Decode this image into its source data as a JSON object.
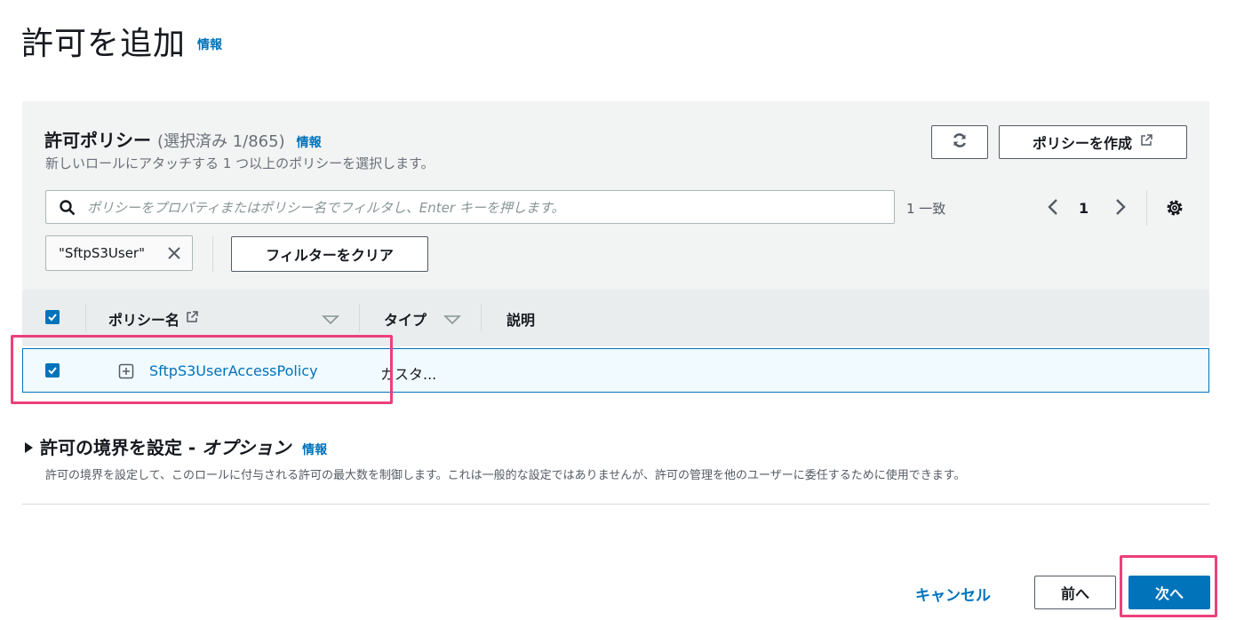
{
  "page": {
    "title": "許可を追加",
    "info": "情報"
  },
  "policies": {
    "title": "許可ポリシー",
    "count": "(選択済み 1/865)",
    "info": "情報",
    "subtitle": "新しいロールにアタッチする 1 つ以上のポリシーを選択します。",
    "refresh_icon": "refresh-icon",
    "create_label": "ポリシーを作成",
    "search_placeholder": "ポリシーをプロパティまたはポリシー名でフィルタし、Enter キーを押します。",
    "match_count": "1 一致",
    "page_number": "1",
    "filter_token": "\"SftpS3User\"",
    "clear_filters_label": "フィルターをクリア",
    "columns": {
      "name": "ポリシー名",
      "type": "タイプ",
      "description": "説明"
    },
    "rows": [
      {
        "name": "SftpS3UserAccessPolicy",
        "type": "カスタ...",
        "selected": true
      }
    ]
  },
  "boundary": {
    "title": "許可の境界を設定 - ",
    "title_option": "オプション",
    "info": "情報",
    "description": "許可の境界を設定して、このロールに付与される許可の最大数を制御します。これは一般的な設定ではありませんが、許可の管理を他のユーザーに委任するために使用できます。"
  },
  "footer": {
    "cancel_label": "キャンセル",
    "prev_label": "前へ",
    "next_label": "次へ"
  },
  "colors": {
    "link": "#0073bb",
    "primary_button": "#0073bb",
    "highlight_annotation": "#ec407a",
    "selected_row_bg": "#f1faff"
  }
}
